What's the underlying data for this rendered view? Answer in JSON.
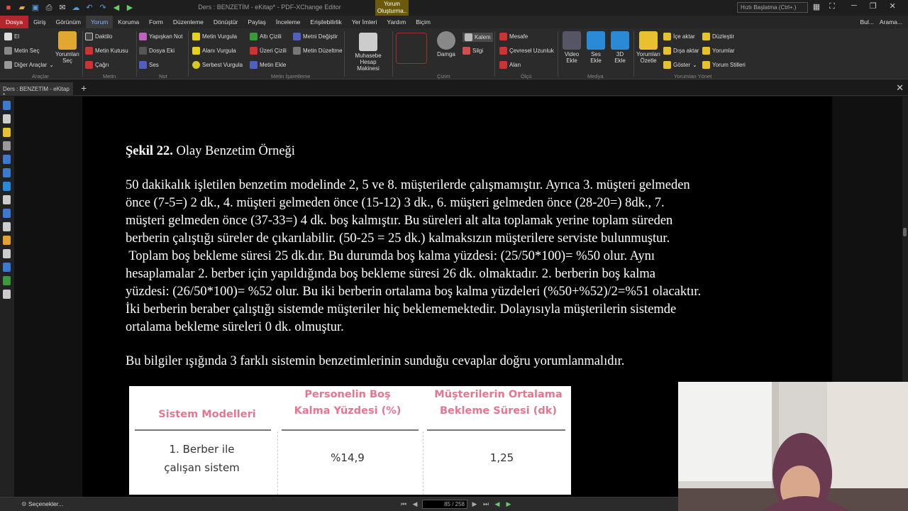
{
  "window": {
    "title": "Ders : BENZETİM - eKitap* - PDF-XChange Editor",
    "context_tab": "Yorum\nOluşturma..",
    "search_placeholder": "Hızlı Başlatma (Ctrl+.)"
  },
  "menu": {
    "items": [
      "Dosya",
      "Giriş",
      "Görünüm",
      "Yorum",
      "Koruma",
      "Form",
      "Düzenleme",
      "Dönüştür",
      "Paylaş",
      "İnceleme",
      "Erişilebilirlik",
      "Yer İmleri",
      "Yardım",
      "Biçim"
    ],
    "active": "Yorum",
    "right_find": "Bul...",
    "right_search": "Arama..."
  },
  "ribbon": {
    "araclar": {
      "el": "El",
      "metin_sec": "Metin Seç",
      "diger": "Diğer Araçlar",
      "yorumlari_sec": "Yorumları\nSeç",
      "label": "Araçlar"
    },
    "metin": {
      "daktilo": "Daktilo",
      "metin_kutusu": "Metin Kutusu",
      "cagri": "Çağrı",
      "label": "Metin"
    },
    "not": {
      "yapiskan": "Yapışkan Not",
      "dosya_eki": "Dosya Eki",
      "ses": "Ses",
      "label": "Not"
    },
    "isaretleme": {
      "metin_vurgula": "Metin Vurgula",
      "alani_vurgula": "Alanı Vurgula",
      "serbest_vurgula": "Serbest Vurgula",
      "alti_cizili": "Altı Çizili",
      "ustu_cizili": "Üzeri Çizili",
      "metin_ekle": "Metin Ekle",
      "metni_degistir": "Metni Değiştir",
      "metin_duzeltme": "Metin Düzeltme",
      "label": "Metin İşaretleme"
    },
    "muhasebe": "Muhasebe Hesap\nMakinesi",
    "cizim": {
      "damga": "Damga",
      "kalem": "Kalem",
      "silgi": "Silgi",
      "label": "Çizim"
    },
    "olcu": {
      "mesafe": "Mesafe",
      "cevresel": "Çevresel Uzunluk",
      "alan": "Alan",
      "label": "Ölçü"
    },
    "medya": {
      "video": "Video\nEkle",
      "ses": "Ses\nEkle",
      "uc_d": "3D\nEkle",
      "label": "Medya"
    },
    "yonet": {
      "ozetle": "Yorumları\nÖzetle",
      "ice": "İçe aktar",
      "disa": "Dışa aktar",
      "goster": "Göster",
      "duzlestir": "Düzleştir",
      "yorumlar": "Yorumlar",
      "stiller": "Yorum Stilleri",
      "label": "Yorumları Yönet"
    }
  },
  "tab": {
    "name": "Ders : BENZETİM - eKitap *"
  },
  "document": {
    "figure_title_bold": "Şekil 22.",
    "figure_title_rest": " Olay Benzetim Örneği",
    "paragraph_lines": [
      "50 dakikalık işletilen benzetim modelinde 2, 5 ve 8. müşterilerde çalışmamıştır. Ayrıca 3. müşteri gelmeden",
      "önce (7-5=) 2 dk., 4. müşteri gelmeden önce (15-12) 3 dk., 6. müşteri gelmeden önce (28-20=) 8dk., 7.",
      "müşteri gelmeden önce (37-33=) 4 dk. boş kalmıştır. Bu süreleri alt alta toplamak yerine toplam süreden",
      "berberin çalıştığı süreler de çıkarılabilir. (50-25 = 25 dk.)  kalmaksızın müşterilere serviste bulunmuştur.",
      " Toplam boş bekleme süresi 25 dk.dır. Bu durumda boş kalma yüzdesi: (25/50*100)= %50 olur. Aynı",
      "hesaplamalar 2. berber için yapıldığında boş bekleme süresi 26 dk. olmaktadır. 2. berberin boş kalma",
      "yüzdesi: (26/50*100)= %52 olur. Bu iki berberin ortalama boş kalma yüzdeleri (%50+%52)/2=%51 olacaktır.",
      "İki berberin beraber çalıştığı sistemde müşteriler hiç beklememektedir. Dolayısıyla müşterilerin sistemde",
      "ortalama bekleme süreleri 0 dk. olmuştur."
    ],
    "conclusion": "Bu bilgiler ışığında 3 farklı sistemin benzetimlerinin sunduğu cevaplar doğru yorumlanmalıdır.",
    "table": {
      "headers": [
        "Sistem Modelleri",
        "Personelin Boş\nKalma Yüzdesi (%)",
        "Müşterilerin Ortalama\nBekleme Süresi (dk)"
      ],
      "rows": [
        [
          "1. Berber ile\nçalışan sistem",
          "%14,9",
          "1,25"
        ]
      ]
    }
  },
  "status": {
    "options": "Seçenekler...",
    "page_current": "85",
    "page_total": "258",
    "page_display": "85 / 258"
  },
  "colors": {
    "menu_file": "#b3262b",
    "accent": "#7ab8ff",
    "table_header": "#e8748f",
    "context_tab": "#6b5a0c"
  }
}
